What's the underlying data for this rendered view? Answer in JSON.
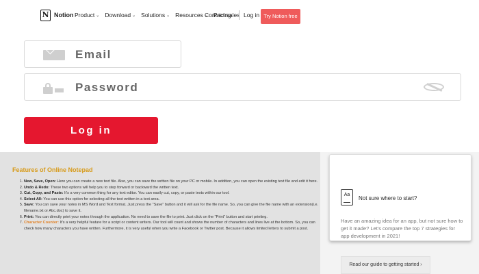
{
  "header": {
    "logo_letter": "N",
    "brand": "Notion",
    "nav": [
      "Product",
      "Download",
      "Solutions",
      "Resources"
    ],
    "pricing": "Pricing",
    "contact_sales": "Contact sales",
    "login": "Log in",
    "try_button": "Try Notion free"
  },
  "form": {
    "email_label": "Email",
    "password_label": "Password",
    "login_button": "Log in"
  },
  "features": {
    "title": "Features of Online Notepad",
    "items": [
      {
        "term": "New, Save, Open:",
        "text": " Here you can create a new text file. Also, you can save the written file on your PC or mobile. In addition, you can open the existing text file and edit it here."
      },
      {
        "term": "Undo & Redo:",
        "text": " These two options will help you to step forward or backward the written text."
      },
      {
        "term": "Cut, Copy, and Paste:",
        "text": " It's a very common thing for any text editor. You can easily cut, copy, or paste texts within our tool."
      },
      {
        "term": "Select All:",
        "text": " You can use this option for selecting all the text written in a text area."
      },
      {
        "term": "Save:",
        "text": " You can save your notes in MS Word and Text format. Just press the \"Save\" button and it will ask for the file name. So, you can give the file name with an extension(i.e. filename.txt or Abc.doc) to save it."
      },
      {
        "term": "Print:",
        "text": " You can directly print your notes through the application. No need to save the file to print. Just click on the \"Print\" button and start printing."
      },
      {
        "term": "Character Counter:",
        "text": " It's a very helpful feature for a script or content writers. Our tool will count and shows the number of characters and lines live at the bottom. So, you can check how many characters you have written. Furthermore, it is very useful when you write a Facebook or Twitter post. Because it allows limited letters to submit a post."
      }
    ]
  },
  "promo": {
    "icon_text": "Aa",
    "title": "Not sure where to start?",
    "text": "Have an amazing idea for an app, but not sure how to get it made? Let's compare the top 7 strategies for app development in 2021!",
    "button": "Read our guide to getting started ›"
  }
}
